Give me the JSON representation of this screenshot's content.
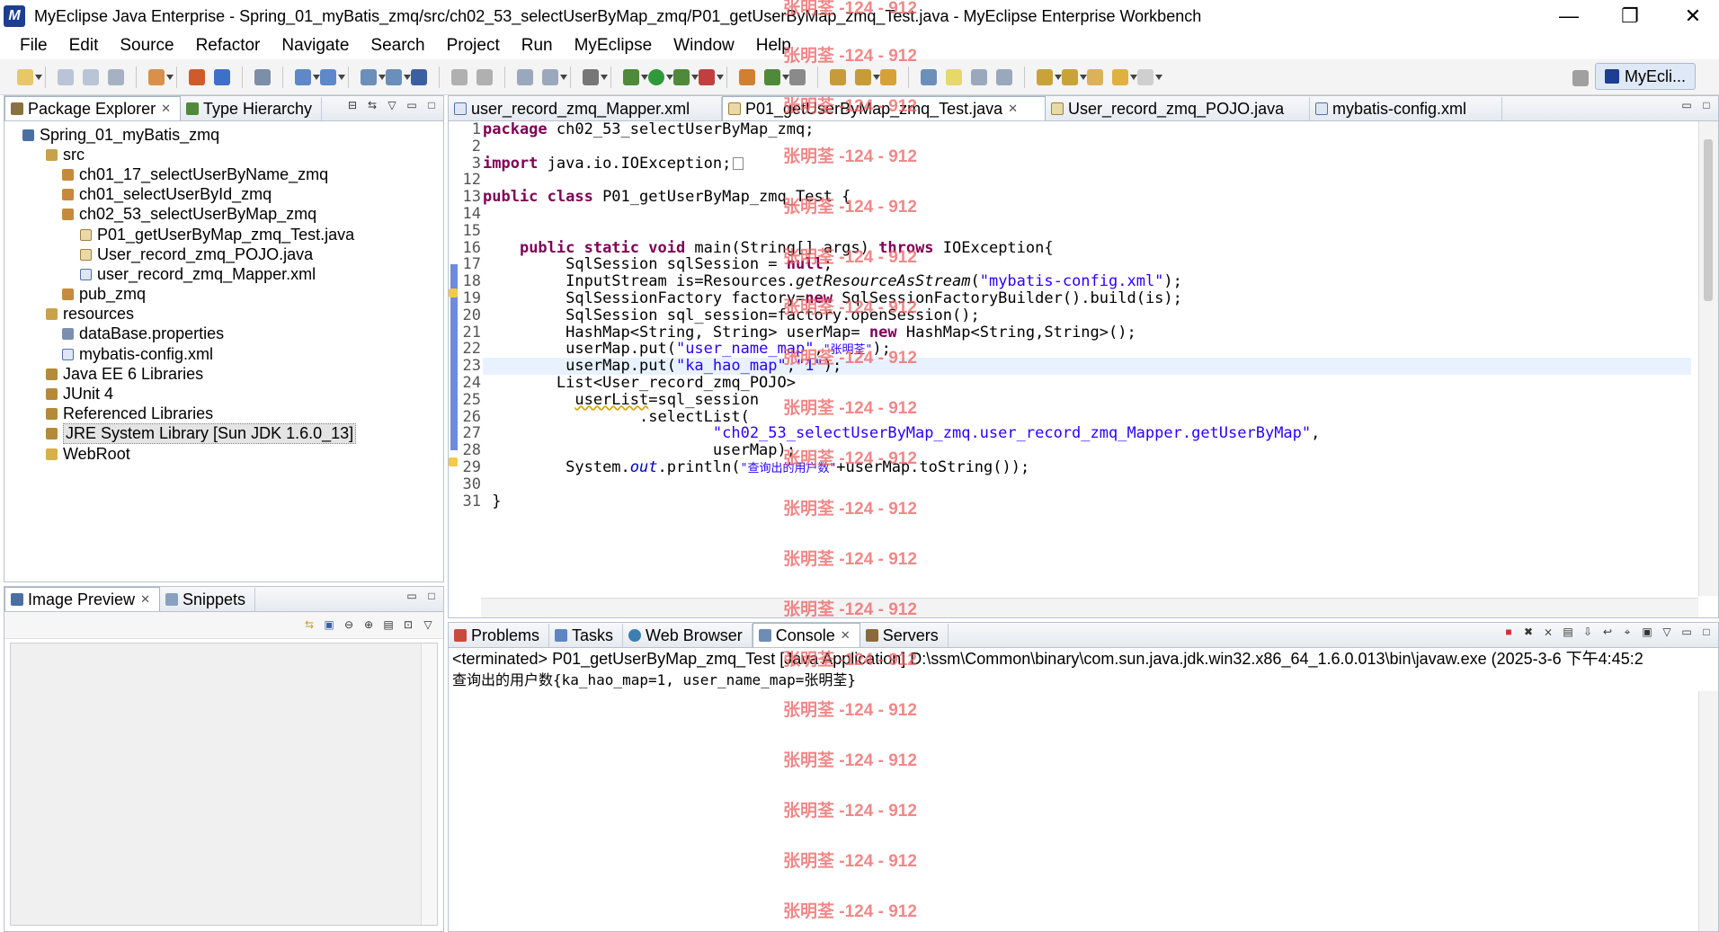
{
  "window": {
    "title": "MyEclipse Java Enterprise - Spring_01_myBatis_zmq/src/ch02_53_selectUserByMap_zmq/P01_getUserByMap_zmq_Test.java - MyEclipse Enterprise Workbench",
    "minimize_symbol": "—",
    "maximize_symbol": "❐",
    "close_symbol": "✕"
  },
  "menu": [
    "File",
    "Edit",
    "Source",
    "Refactor",
    "Navigate",
    "Search",
    "Project",
    "Run",
    "MyEclipse",
    "Window",
    "Help"
  ],
  "perspective": {
    "label": "MyEcli..."
  },
  "explorer": {
    "tabs": [
      "Package Explorer",
      "Type Hierarchy"
    ],
    "tree": [
      {
        "label": "Spring_01_myBatis_zmq",
        "icon": "project-icon"
      },
      {
        "label": "src",
        "icon": "source-folder-icon"
      },
      {
        "label": "ch01_17_selectUserByName_zmq",
        "icon": "package-icon"
      },
      {
        "label": "ch01_selectUserById_zmq",
        "icon": "package-icon"
      },
      {
        "label": "ch02_53_selectUserByMap_zmq",
        "icon": "package-icon"
      },
      {
        "label": "P01_getUserByMap_zmq_Test.java",
        "icon": "java-file-icon"
      },
      {
        "label": "User_record_zmq_POJO.java",
        "icon": "java-file-icon"
      },
      {
        "label": "user_record_zmq_Mapper.xml",
        "icon": "xml-file-icon"
      },
      {
        "label": "pub_zmq",
        "icon": "package-icon"
      },
      {
        "label": "resources",
        "icon": "source-folder-icon"
      },
      {
        "label": "dataBase.properties",
        "icon": "properties-file-icon"
      },
      {
        "label": "mybatis-config.xml",
        "icon": "xml-file-icon"
      },
      {
        "label": "Java EE 6 Libraries",
        "icon": "library-icon"
      },
      {
        "label": "JUnit 4",
        "icon": "library-icon"
      },
      {
        "label": "Referenced Libraries",
        "icon": "library-icon"
      },
      {
        "label": "JRE System Library [Sun JDK 1.6.0_13]",
        "icon": "library-icon"
      },
      {
        "label": "WebRoot",
        "icon": "folder-icon"
      }
    ]
  },
  "preview": {
    "tabs": [
      "Image Preview",
      "Snippets"
    ]
  },
  "editor": {
    "tabs": [
      "user_record_zmq_Mapper.xml",
      "P01_getUserByMap_zmq_Test.java",
      "User_record_zmq_POJO.java",
      "mybatis-config.xml"
    ],
    "line_numbers": [
      "1",
      "2",
      "3",
      "12",
      "13",
      "14",
      "15",
      "16",
      "17",
      "18",
      "19",
      "20",
      "21",
      "22",
      "23",
      "24",
      "25",
      "26",
      "27",
      "28",
      "29",
      "30",
      "31"
    ],
    "code": {
      "l1_kw": "package",
      "l1_rest": " ch02_53_selectUserByMap_zmq;",
      "l3_kw": "import",
      "l3_rest": " java.io.IOException;",
      "l13_kw": "public class",
      "l13_rest": " P01_getUserByMap_zmq_Test {",
      "l16_kw1": "public static void",
      "l16_mid": " main(String[] args) ",
      "l16_kw2": "throws",
      "l16_rest": " IOException{",
      "l17_pre": "SqlSession sqlSession = ",
      "l17_kw": "null",
      "l17_post": ";",
      "l18_pre": "InputStream is=Resources.",
      "l18_it": "getResourceAsStream",
      "l18_open": "(",
      "l18_str": "\"mybatis-config.xml\"",
      "l18_post": ");",
      "l19_pre": "SqlSessionFactory factory=",
      "l19_kw": "new",
      "l19_post": " SqlSessionFactoryBuilder().build(is);",
      "l20": "SqlSession sql_session=factory.openSession();",
      "l21_pre": "HashMap<String, String> userMap= ",
      "l21_kw": "new",
      "l21_post": " HashMap<String,String>();",
      "l22_pre": "userMap.put(",
      "l22_str1": "\"user_name_map\"",
      "l22_comma": ",",
      "l22_str2": "\"张明荃\"",
      "l22_post": ");",
      "l23_pre": "userMap.put(",
      "l23_str1": "\"ka_hao_map\"",
      "l23_comma": ",",
      "l23_str2": "\"1\"",
      "l23_post": ");",
      "l24": "List<User_record_zmq_POJO>",
      "l25_u": "userList",
      "l25_post": "=sql_session",
      "l26": ".selectList(",
      "l27_str": "\"ch02_53_selectUserByMap_zmq.user_record_zmq_Mapper.getUserByMap\"",
      "l27_post": ",",
      "l28": "userMap);",
      "l29_pre": "System.",
      "l29_out": "out",
      "l29_mid": ".println(",
      "l29_str": "\"查询出的用户数\"",
      "l29_post": "+userMap.toString());",
      "l31": "}"
    }
  },
  "console": {
    "tabs": [
      "Problems",
      "Tasks",
      "Web Browser",
      "Console",
      "Servers"
    ],
    "header": "<terminated> P01_getUserByMap_zmq_Test [Java Application] D:\\ssm\\Common\\binary\\com.sun.java.jdk.win32.x86_64_1.6.0.013\\bin\\javaw.exe (2025-3-6 下午4:45:2",
    "output": "查询出的用户数{ka_hao_map=1, user_name_map=张明荃}"
  },
  "watermark": "张明荃 -124 - 912",
  "colors": {
    "keyword": "#7f0055",
    "string": "#2a00ff",
    "watermark": "#ec6060",
    "current_line": "#e8f2fe"
  }
}
